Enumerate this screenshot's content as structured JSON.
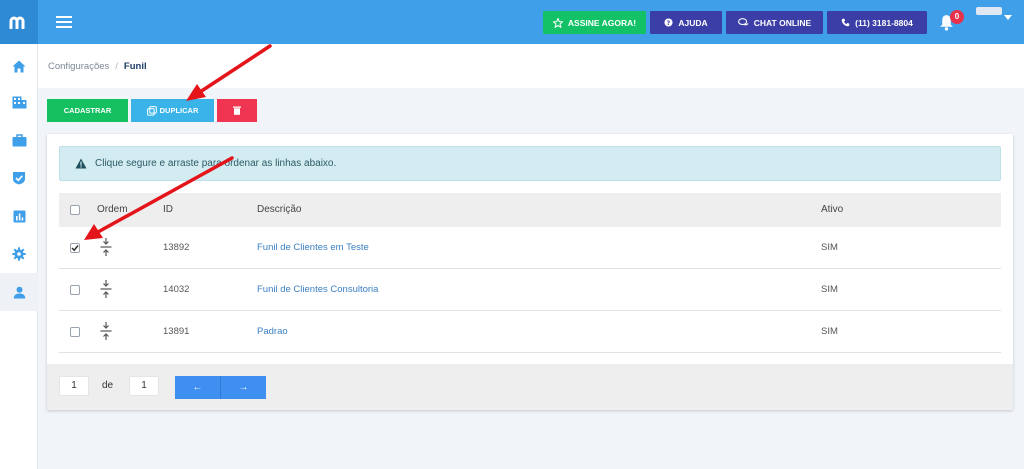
{
  "topbar": {
    "assine_label": "ASSINE AGORA!",
    "ajuda_label": "AJUDA",
    "chat_label": "CHAT ONLINE",
    "phone_label": "(11) 3181-8804",
    "notifications_count": "0",
    "colors": {
      "bar": "#3f9fe8",
      "green": "#13c266",
      "navy": "#3b3ea6"
    }
  },
  "sidebar": {
    "items": [
      {
        "icon": "home-icon"
      },
      {
        "icon": "building-icon"
      },
      {
        "icon": "briefcase-icon"
      },
      {
        "icon": "shield-check-icon"
      },
      {
        "icon": "bar-chart-icon"
      },
      {
        "icon": "gear-icon"
      },
      {
        "icon": "user-icon",
        "active": true
      }
    ]
  },
  "breadcrumb": {
    "parent": "Configurações",
    "separator": "/",
    "current": "Funil"
  },
  "actions": {
    "cadastrar_label": "CADASTRAR",
    "duplicar_label": "DUPLICAR"
  },
  "alert": {
    "text": "Clique segure e arraste para ordenar as linhas abaixo."
  },
  "table": {
    "headers": {
      "ordem": "Ordem",
      "id": "ID",
      "descricao": "Descrição",
      "ativo": "Ativo"
    },
    "rows": [
      {
        "checked": true,
        "id": "13892",
        "descricao": "Funil de Clientes em Teste",
        "ativo": "SIM"
      },
      {
        "checked": false,
        "id": "14032",
        "descricao": "Funil de Clientes Consultoria",
        "ativo": "SIM"
      },
      {
        "checked": false,
        "id": "13891",
        "descricao": "Padrao",
        "ativo": "SIM"
      }
    ]
  },
  "pagination": {
    "current": "1",
    "of_label": "de",
    "total": "1",
    "prev": "←",
    "next": "→"
  },
  "annotations": {
    "arrow_color": "#e3141a"
  }
}
